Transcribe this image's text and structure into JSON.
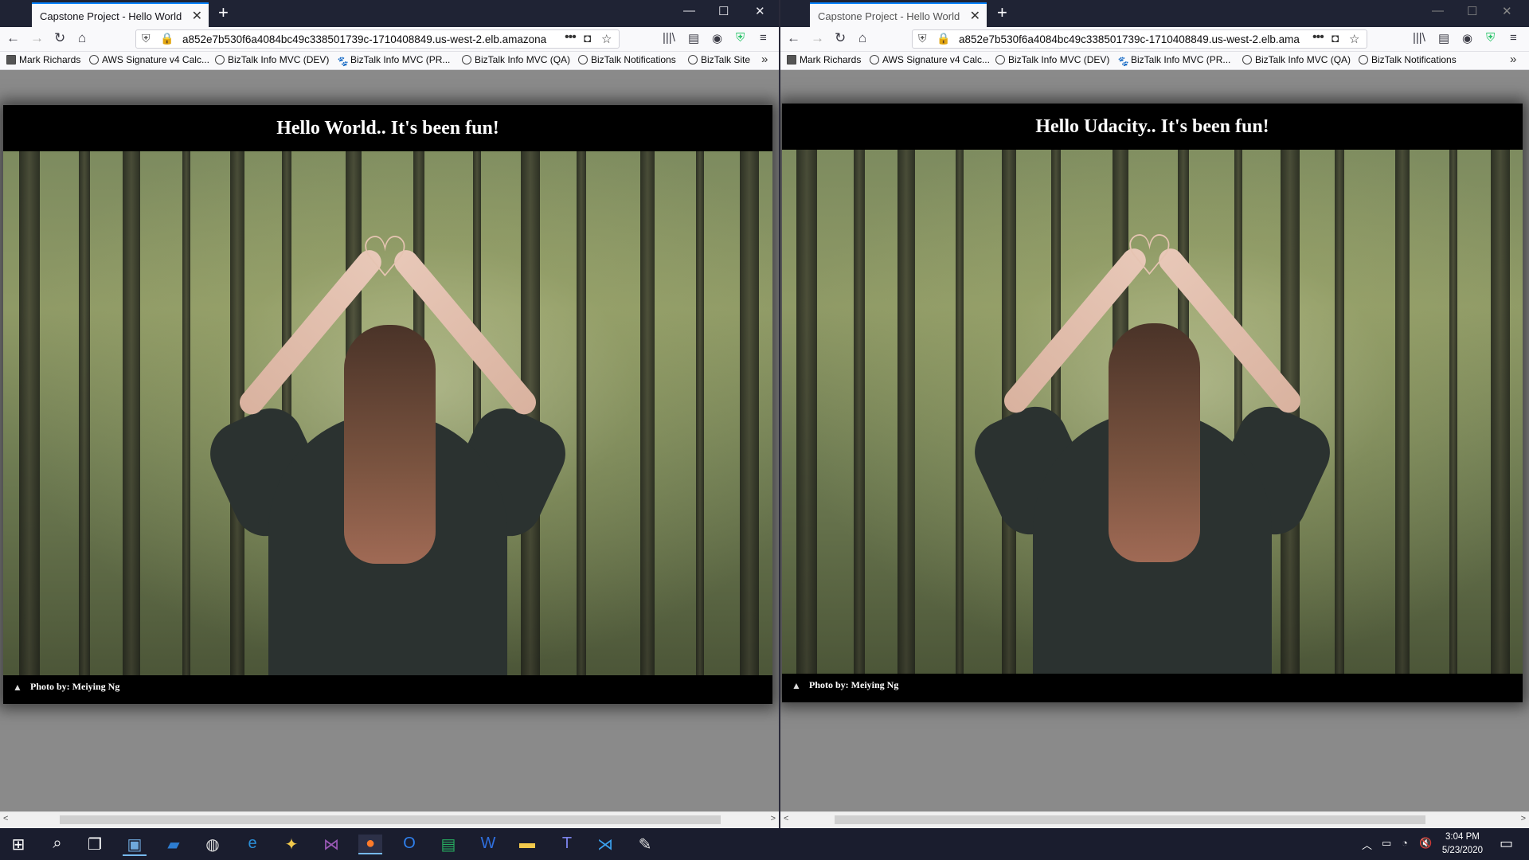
{
  "windows": [
    {
      "tab_title": "Capstone Project - Hello World",
      "url": "a852e7b530f6a4084bc49c338501739c-1710408849.us-west-2.elb.amazona",
      "bookmarks": [
        "Mark Richards",
        "AWS Signature v4 Calc...",
        "BizTalk Info MVC (DEV)",
        "BizTalk Info MVC (PR...",
        "BizTalk Info MVC (QA)",
        "BizTalk Notifications",
        "BizTalk Site"
      ],
      "headline": "Hello World.. It's been fun!",
      "caption": "Photo by: Meiying Ng"
    },
    {
      "tab_title": "Capstone Project - Hello World",
      "url": "a852e7b530f6a4084bc49c338501739c-1710408849.us-west-2.elb.ama",
      "bookmarks": [
        "Mark Richards",
        "AWS Signature v4 Calc...",
        "BizTalk Info MVC (DEV)",
        "BizTalk Info MVC (PR...",
        "BizTalk Info MVC (QA)",
        "BizTalk Notifications"
      ],
      "headline": "Hello Udacity.. It's been fun!",
      "caption": "Photo by: Meiying Ng"
    }
  ],
  "icons": {
    "back": "←",
    "forward": "→",
    "reload": "↻",
    "home": "⌂",
    "more": "•••",
    "star": "☆",
    "pocket": "◘",
    "library": "|||\\",
    "sidebar": "▤",
    "account": "◉",
    "shield": "⛨",
    "menu": "≡",
    "overflow": "»",
    "close": "✕",
    "newtab": "+",
    "minimize": "—",
    "maximize": "☐",
    "camera": "▲"
  },
  "taskbar": {
    "time": "3:04 PM",
    "date": "5/23/2020",
    "apps": [
      "start-icon",
      "search-icon",
      "task-view-icon",
      "remote-desktop-icon",
      "powershell-icon",
      "chrome-icon",
      "edge-icon",
      "app-icon",
      "visual-studio-icon",
      "firefox-icon",
      "outlook-icon",
      "project-icon",
      "word-icon",
      "file-explorer-icon",
      "teams-icon",
      "vscode-icon",
      "paint-icon"
    ]
  },
  "colors": {
    "accent": "#0a84ff",
    "page_bg": "#8a8a8a",
    "taskbar": "#1a1d2e"
  }
}
